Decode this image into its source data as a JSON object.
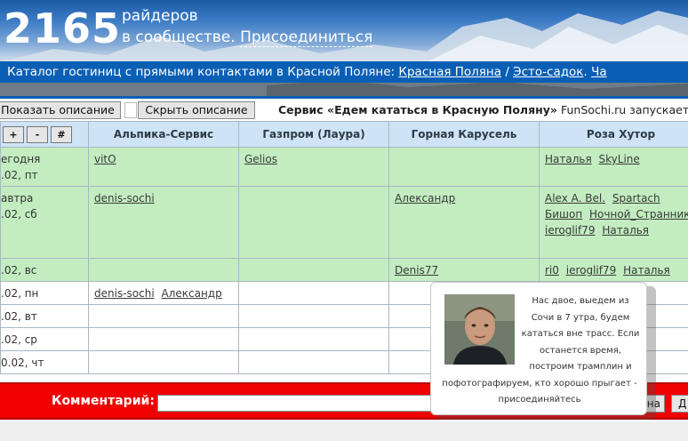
{
  "header": {
    "rider_count": "2165",
    "riders_word": "райдеров",
    "community_text": "в сообществе.",
    "join_link": "Присоединиться"
  },
  "catalog": {
    "text": "Каталог гостиниц с прямыми контактами в Красной Поляне:",
    "link1": "Красная Поляна",
    "separator": "/",
    "link2": "Эсто-садок",
    "link3_partial": "Ча"
  },
  "toolbar": {
    "show_desc": "Показать описание",
    "hide_desc": "Скрыть описание",
    "service_bold": "Сервис «Едем кататься в Красную Поляну»",
    "service_rest": "FunSochi.ru запускает се"
  },
  "table": {
    "controls": [
      "+",
      "-",
      "#"
    ],
    "columns": [
      "Альпика-Сервис",
      "Газпром (Лаура)",
      "Горная Карусель",
      "Роза Хутор"
    ],
    "rows": [
      {
        "day": "егодня",
        "date": ".02, пт",
        "style": "green",
        "cells": [
          [
            "vitO"
          ],
          [
            "Gelios"
          ],
          [],
          [
            "Наталья",
            "SkyLine"
          ]
        ]
      },
      {
        "day": "автра",
        "date": ".02, сб",
        "style": "green",
        "cells": [
          [
            "denis-sochi"
          ],
          [],
          [
            "Александр"
          ],
          [
            "Alex A. Bel.",
            "Spartach",
            "Бишоп",
            "Ночной_Странник",
            "ieroglif79",
            "Наталья"
          ]
        ]
      },
      {
        "day": ".02, вс",
        "date": "",
        "style": "green",
        "cells": [
          [],
          [],
          [
            "Denis77"
          ],
          [
            "ri0",
            "ieroglif79",
            "Наталья"
          ]
        ]
      },
      {
        "day": ".02, пн",
        "date": "",
        "style": "white",
        "cells": [
          [
            "denis-sochi",
            "Александр"
          ],
          [],
          [],
          []
        ]
      },
      {
        "day": ".02, вт",
        "date": "",
        "style": "white",
        "cells": [
          [],
          [],
          [],
          []
        ]
      },
      {
        "day": ".02, ср",
        "date": "",
        "style": "white",
        "cells": [
          [],
          [],
          [],
          []
        ]
      },
      {
        "day": "0.02, чт",
        "date": "",
        "style": "white",
        "cells": [
          [],
          [],
          [],
          []
        ]
      }
    ]
  },
  "comment": {
    "label": "Комментарий:",
    "button1_partial": "на",
    "button2_partial": "Д"
  },
  "tooltip": {
    "text": "Нас двое, выедем из Сочи в 7 утра, будем кататься вне трасс. Если останется время, построим трамплин и пофотографируем, кто хорошо прыгает - присоединяйтесь",
    "photo_icon": "user-avatar-photo"
  },
  "colors": {
    "brand_blue": "#0a5fb5",
    "row_green": "#c3edc0",
    "header_cell": "#cfe3f6",
    "comment_red": "#f00000"
  }
}
